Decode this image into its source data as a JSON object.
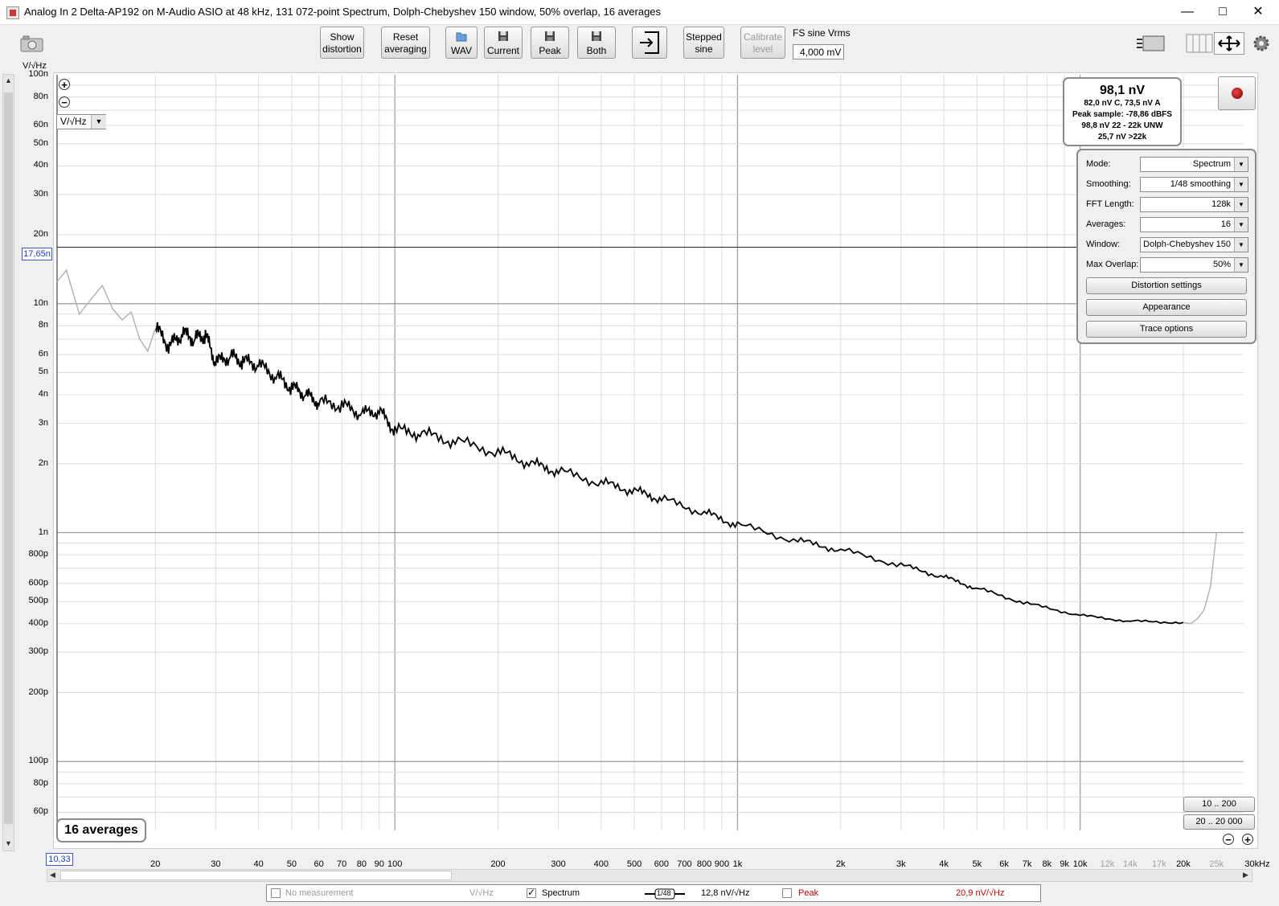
{
  "window": {
    "title": "Analog In 2 Delta-AP192 on M-Audio ASIO at 48 kHz, 131 072-point Spectrum, Dolph-Chebyshev 150 window, 50% overlap, 16 averages",
    "minimize_icon": "minimize-icon",
    "maximize_icon": "maximize-icon",
    "close_icon": "close-icon"
  },
  "toolbar": {
    "show_distortion": [
      "Show",
      "distortion"
    ],
    "reset_averaging": [
      "Reset",
      "averaging"
    ],
    "wav": "WAV",
    "current": "Current",
    "peak": "Peak",
    "both": "Both",
    "stepped_sine": [
      "Stepped",
      "sine"
    ],
    "calibrate_level": [
      "Calibrate",
      "level"
    ],
    "fs_label": "FS sine Vrms",
    "fs_value": "4,000 mV"
  },
  "plot": {
    "y_unit": "V/√Hz",
    "unit_select": "V/√Hz",
    "cursor_y": "17,65n",
    "cursor_x": "10,33",
    "averages_badge": "16 averages",
    "range_buttons": [
      "10 .. 200",
      "20 .. 20 000"
    ]
  },
  "readout": {
    "main": "98,1 nV",
    "lines": [
      "82,0 nV C, 73,5 nV A",
      "Peak sample: -78,86 dBFS",
      "98,8 nV 22 - 22k UNW",
      "25,7 nV >22k"
    ]
  },
  "settings": {
    "rows": [
      {
        "label": "Mode:",
        "value": "Spectrum"
      },
      {
        "label": "Smoothing:",
        "value": "1/48 smoothing"
      },
      {
        "label": "FFT Length:",
        "value": "128k"
      },
      {
        "label": "Averages:",
        "value": "16"
      },
      {
        "label": "Window:",
        "value": "Dolph-Chebyshev 150"
      },
      {
        "label": "Max Overlap:",
        "value": "50%"
      }
    ],
    "buttons": [
      "Distortion settings",
      "Appearance",
      "Trace options"
    ]
  },
  "legend": {
    "no_measurement": "No measurement",
    "no_measurement_unit": "V/√Hz",
    "spectrum": "Spectrum",
    "smoothing_badge": "1/48",
    "spectrum_value": "12,8 nV/√Hz",
    "peak": "Peak",
    "peak_value": "20,9 nV/√Hz",
    "peak_color": "#c00000"
  },
  "chart_data": {
    "type": "line",
    "x_scale": "log",
    "y_scale": "log",
    "xlim": [
      10.33,
      30000
    ],
    "ylim": [
      5e-11,
      1e-07
    ],
    "x_ticks": [
      "20",
      "30",
      "40",
      "50",
      "60",
      "70",
      "80",
      "90",
      "100",
      "200",
      "300",
      "400",
      "500",
      "600",
      "700",
      "800",
      "900",
      "1k",
      "2k",
      "3k",
      "4k",
      "5k",
      "6k",
      "7k",
      "8k",
      "9k",
      "10k",
      "12k",
      "14k",
      "17k",
      "20k",
      "25k",
      "30kHz"
    ],
    "x_tick_values": [
      20,
      30,
      40,
      50,
      60,
      70,
      80,
      90,
      100,
      200,
      300,
      400,
      500,
      600,
      700,
      800,
      900,
      1000,
      2000,
      3000,
      4000,
      5000,
      6000,
      7000,
      8000,
      9000,
      10000,
      12000,
      14000,
      17000,
      20000,
      25000,
      30000
    ],
    "x_tick_grey": [
      "12k",
      "14k",
      "17k",
      "25k"
    ],
    "y_ticks": [
      "100n",
      "80n",
      "60n",
      "50n",
      "40n",
      "30n",
      "20n",
      "10n",
      "8n",
      "6n",
      "5n",
      "4n",
      "3n",
      "2n",
      "1n",
      "800p",
      "600p",
      "500p",
      "400p",
      "300p",
      "200p",
      "100p",
      "80p",
      "60p"
    ],
    "y_tick_values": [
      1e-07,
      8e-08,
      6e-08,
      5e-08,
      4e-08,
      3e-08,
      2e-08,
      1e-08,
      8e-09,
      6e-09,
      5e-09,
      4e-09,
      3e-09,
      2e-09,
      1e-09,
      8e-10,
      6e-10,
      5e-10,
      4e-10,
      3e-10,
      2e-10,
      1e-10,
      8e-11,
      6e-11
    ],
    "cursor_value": 1.765e-08,
    "series": [
      {
        "name": "Spectrum",
        "color": "#000000",
        "x": [
          20,
          22,
          24,
          26,
          28,
          30,
          33,
          36,
          40,
          45,
          50,
          55,
          60,
          70,
          80,
          90,
          100,
          120,
          150,
          200,
          250,
          300,
          400,
          500,
          600,
          800,
          1000,
          1500,
          2000,
          3000,
          4000,
          5000,
          7000,
          10000,
          14000,
          20000
        ],
        "y": [
          7.8e-09,
          6.5e-09,
          7.4e-09,
          7e-09,
          7.3e-09,
          5.5e-09,
          5.9e-09,
          5.6e-09,
          5.4e-09,
          4.8e-09,
          4.3e-09,
          4e-09,
          3.7e-09,
          3.6e-09,
          3.3e-09,
          3.4e-09,
          2.8e-09,
          2.7e-09,
          2.5e-09,
          2.25e-09,
          2e-09,
          1.85e-09,
          1.65e-09,
          1.52e-09,
          1.4e-09,
          1.22e-09,
          1.08e-09,
          9.2e-10,
          8.4e-10,
          7.2e-10,
          6.4e-10,
          5.7e-10,
          4.9e-10,
          4.35e-10,
          4.1e-10,
          4.05e-10
        ]
      },
      {
        "name": "",
        "color": "#b0b0b0",
        "x": [
          10.33,
          11,
          12,
          13,
          14,
          15,
          16,
          17,
          18,
          19,
          20
        ],
        "y": [
          1.25e-08,
          1.4e-08,
          9e-09,
          1.05e-08,
          1.2e-08,
          9.5e-09,
          8.5e-09,
          9.2e-09,
          7e-09,
          6.2e-09,
          7.8e-09
        ]
      },
      {
        "name": "",
        "color": "#b0b0b0",
        "x": [
          20000,
          21000,
          22000,
          23000,
          24000,
          25000
        ],
        "y": [
          4.05e-10,
          4e-10,
          4.2e-10,
          4.6e-10,
          5.8e-10,
          1e-09
        ]
      }
    ]
  }
}
